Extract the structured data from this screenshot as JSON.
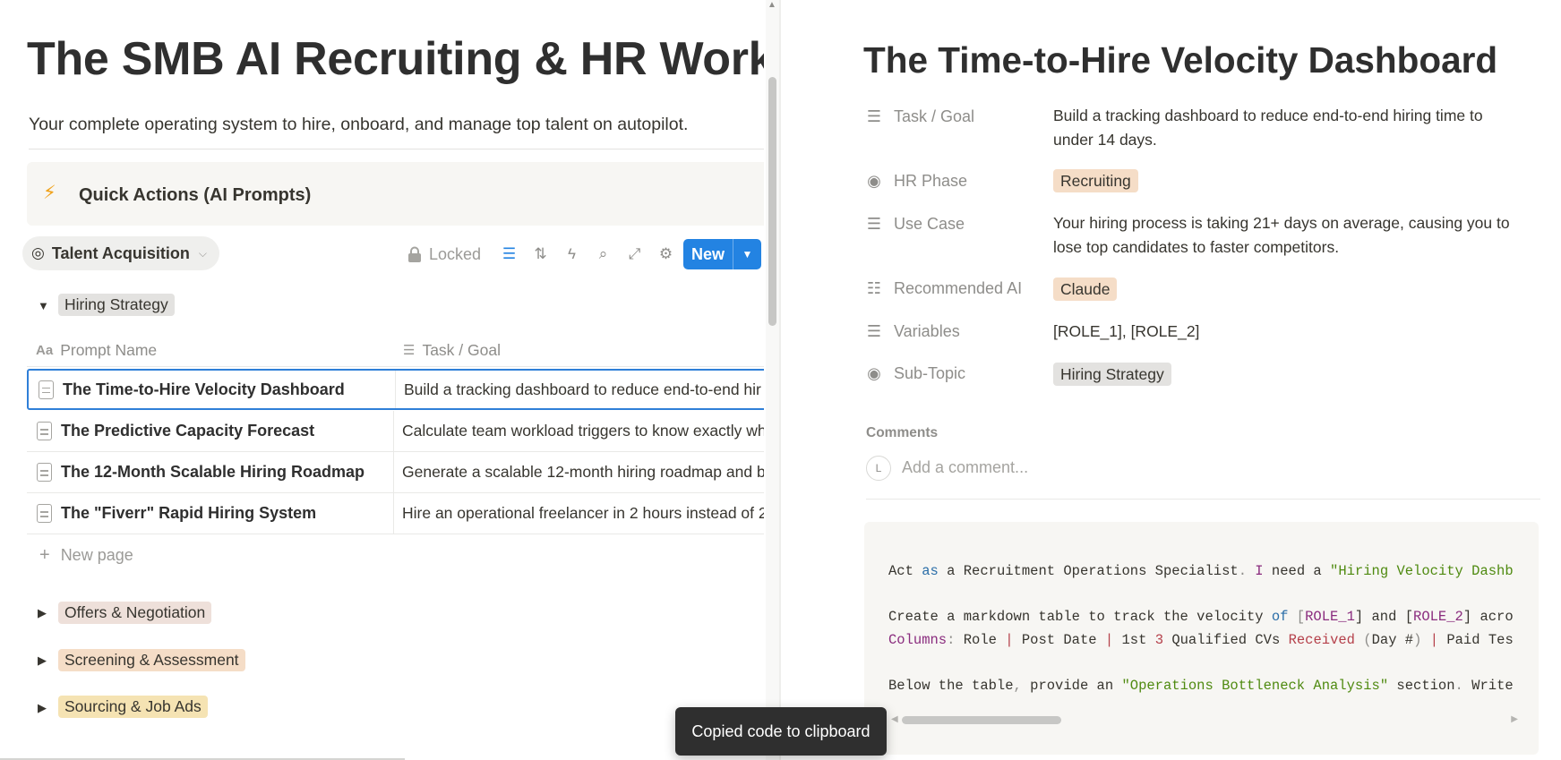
{
  "database": {
    "title": "The SMB AI Recruiting & HR Workspace",
    "subtitle": "Your complete operating system to hire, onboard, and manage top talent on autopilot.",
    "callout": {
      "icon": "lightning-icon",
      "text": "Quick Actions (AI Prompts)"
    },
    "view": {
      "label": "Talent Acquisition",
      "icon": "target-icon"
    },
    "toolbar": {
      "locked_label": "Locked",
      "icons": [
        "filter-icon",
        "sort-icon",
        "automation-icon",
        "search-icon",
        "expand-icon",
        "settings-icon"
      ],
      "new_label": "New"
    },
    "groups": [
      {
        "label": "Hiring Strategy",
        "expanded": true,
        "color": "gray"
      },
      {
        "label": "Offers & Negotiation",
        "expanded": false,
        "color": "brown"
      },
      {
        "label": "Screening & Assessment",
        "expanded": false,
        "color": "orange"
      },
      {
        "label": "Sourcing & Job Ads",
        "expanded": false,
        "color": "yellow"
      }
    ],
    "columns": [
      {
        "icon": "Aa",
        "label": "Prompt Name"
      },
      {
        "icon": "text-icon",
        "label": "Task / Goal"
      }
    ],
    "rows": [
      {
        "name": "The Time-to-Hire Velocity Dashboard",
        "goal": "Build a tracking dashboard to reduce end-to-end hir"
      },
      {
        "name": "The Predictive Capacity Forecast",
        "goal": "Calculate team workload triggers to know exactly wh"
      },
      {
        "name": "The 12-Month Scalable Hiring Roadmap",
        "goal": "Generate a scalable 12-month hiring roadmap and b"
      },
      {
        "name": "The \"Fiverr\" Rapid Hiring System",
        "goal": "Hire an operational freelancer in 2 hours instead of 2"
      }
    ],
    "new_page_label": "New page"
  },
  "detail": {
    "title": "The Time-to-Hire Velocity Dashboard",
    "properties": {
      "task_goal": {
        "label": "Task / Goal",
        "value": "Build a tracking dashboard to reduce end-to-end hiring time to under 14 days."
      },
      "hr_phase": {
        "label": "HR Phase",
        "value": "Recruiting"
      },
      "use_case": {
        "label": "Use Case",
        "value": "Your hiring process is taking 21+ days on average, causing you to lose top candidates to faster competitors."
      },
      "recommended_ai": {
        "label": "Recommended AI",
        "value": "Claude"
      },
      "variables": {
        "label": "Variables",
        "value": "[ROLE_1], [ROLE_2]"
      },
      "sub_topic": {
        "label": "Sub-Topic",
        "value": "Hiring Strategy"
      }
    },
    "comments": {
      "heading": "Comments",
      "avatar": "L",
      "placeholder": "Add a comment..."
    },
    "code": {
      "line1": {
        "p1": "Act ",
        "p2": "as",
        "p3": " a Recruitment Operations Specialist",
        "p4": ".",
        "p5": " I",
        "p6": " need a ",
        "p7": "\"Hiring Velocity Dashb"
      },
      "line2": {
        "p1": "Create a markdown table to track the velocity ",
        "p2": "of",
        "p3": " [",
        "p4": "ROLE_1",
        "p5": "] and [",
        "p6": "ROLE_2",
        "p7": "] acro"
      },
      "line3": {
        "p1": "Columns",
        "p2": ":",
        "p3": " Role ",
        "p4": "|",
        "p5": " Post Date ",
        "p6": "|",
        "p7": " 1st ",
        "p8": "3",
        "p9": " Qualified CVs ",
        "p10": "Received",
        "p11": " (",
        "p12": "Day #",
        "p13": ") ",
        "p14": "|",
        "p15": " Paid Tes"
      },
      "line4": {
        "p1": "Below the table",
        "p2": ",",
        "p3": " provide an ",
        "p4": "\"Operations Bottleneck Analysis\"",
        "p5": " section",
        "p6": ".",
        "p7": " Write"
      }
    }
  },
  "toast": {
    "text": "Copied code to clipboard"
  },
  "colors": {
    "accent": "#2383e2",
    "tag_gray": "#e3e2e0",
    "tag_brown": "#eee0da",
    "tag_orange": "#f5ddc7",
    "tag_yellow": "#f5e3b3"
  }
}
